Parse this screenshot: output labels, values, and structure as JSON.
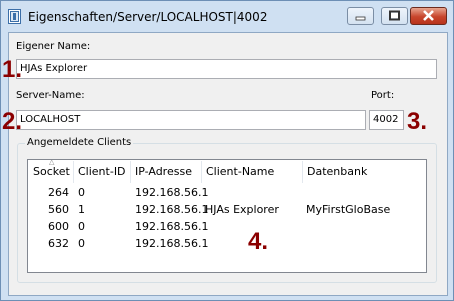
{
  "window": {
    "title": "Eigenschaften/Server/LOCALHOST|4002"
  },
  "form": {
    "own_name_label": "Eigener Name:",
    "own_name_value": "HJAs Explorer",
    "server_name_label": "Server-Name:",
    "server_name_value": "LOCALHOST",
    "port_label": "Port:",
    "port_value": "4002"
  },
  "annotations": {
    "n1": "1.",
    "n2": "2.",
    "n3": "3.",
    "n4": "4."
  },
  "clients": {
    "group_label": "Angemeldete Clients",
    "columns": [
      "Socket",
      "Client-ID",
      "IP-Adresse",
      "Client-Name",
      "Datenbank"
    ],
    "rows": [
      [
        "264",
        "0",
        "192.168.56.1",
        "",
        ""
      ],
      [
        "560",
        "1",
        "192.168.56.1",
        "HJAs Explorer",
        "MyFirstGloBase"
      ],
      [
        "600",
        "0",
        "192.168.56.1",
        "",
        ""
      ],
      [
        "632",
        "0",
        "192.168.56.1",
        "",
        ""
      ]
    ]
  },
  "colors": {
    "annotation": "#8b0000",
    "frame": "#cfe0f2"
  },
  "icons": {
    "title": "server-app-icon",
    "minimize": "minimize-icon",
    "maximize": "maximize-icon",
    "close": "close-icon",
    "sort": "sort-arrow-icon"
  }
}
